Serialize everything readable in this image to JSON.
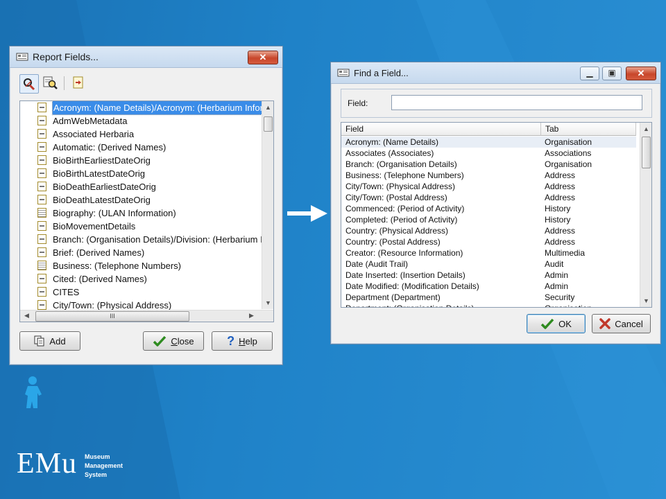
{
  "colors": {
    "background": "#1e7fc4",
    "selection": "#3a8ce8",
    "close_button": "#c8462b"
  },
  "report_fields": {
    "title": "Report Fields...",
    "toolbar_icons": [
      "search-field-icon",
      "search-text-icon",
      "insert-field-icon"
    ],
    "items": [
      {
        "label": "Acronym: (Name Details)/Acronym: (Herbarium Inform",
        "icon": "single",
        "selected": true
      },
      {
        "label": "AdmWebMetadata",
        "icon": "single"
      },
      {
        "label": "Associated Herbaria",
        "icon": "single"
      },
      {
        "label": "Automatic: (Derived Names)",
        "icon": "single"
      },
      {
        "label": "BioBirthEarliestDateOrig",
        "icon": "single"
      },
      {
        "label": "BioBirthLatestDateOrig",
        "icon": "single"
      },
      {
        "label": "BioDeathEarliestDateOrig",
        "icon": "single"
      },
      {
        "label": "BioDeathLatestDateOrig",
        "icon": "single"
      },
      {
        "label": "Biography: (ULAN Information)",
        "icon": "multi"
      },
      {
        "label": "BioMovementDetails",
        "icon": "single"
      },
      {
        "label": "Branch: (Organisation Details)/Division: (Herbarium In",
        "icon": "single"
      },
      {
        "label": "Brief: (Derived Names)",
        "icon": "single"
      },
      {
        "label": "Business: (Telephone Numbers)",
        "icon": "multi"
      },
      {
        "label": "Cited: (Derived Names)",
        "icon": "single"
      },
      {
        "label": "CITES",
        "icon": "single"
      },
      {
        "label": "City/Town: (Physical Address)",
        "icon": "single"
      }
    ],
    "hscroll_grip": "III",
    "add_label": "Add",
    "close_label_u": "C",
    "close_label_rest": "lose",
    "help_label_u": "H",
    "help_label_rest": "elp"
  },
  "find_field": {
    "title": "Find a Field...",
    "field_label": "Field:",
    "field_value": "",
    "columns": [
      "Field",
      "Tab"
    ],
    "rows": [
      {
        "field": "Acronym: (Name Details)",
        "tab": "Organisation",
        "selected": true
      },
      {
        "field": "Associates (Associates)",
        "tab": "Associations"
      },
      {
        "field": "Branch: (Organisation Details)",
        "tab": "Organisation"
      },
      {
        "field": "Business: (Telephone Numbers)",
        "tab": "Address"
      },
      {
        "field": "City/Town: (Physical Address)",
        "tab": "Address"
      },
      {
        "field": "City/Town: (Postal Address)",
        "tab": "Address"
      },
      {
        "field": "Commenced: (Period of Activity)",
        "tab": "History"
      },
      {
        "field": "Completed: (Period of Activity)",
        "tab": "History"
      },
      {
        "field": "Country: (Physical Address)",
        "tab": "Address"
      },
      {
        "field": "Country: (Postal Address)",
        "tab": "Address"
      },
      {
        "field": "Creator: (Resource Information)",
        "tab": "Multimedia"
      },
      {
        "field": "Date (Audit Trail)",
        "tab": "Audit"
      },
      {
        "field": "Date Inserted: (Insertion Details)",
        "tab": "Admin"
      },
      {
        "field": "Date Modified: (Modification Details)",
        "tab": "Admin"
      },
      {
        "field": "Department (Department)",
        "tab": "Security"
      },
      {
        "field": "Department: (Organisation Details)",
        "tab": "Organisation"
      }
    ],
    "ok_label": "OK",
    "cancel_label": "Cancel"
  },
  "logo": {
    "wordmark": "EMu",
    "line1": "Museum",
    "line2": "Management",
    "line3": "System"
  }
}
